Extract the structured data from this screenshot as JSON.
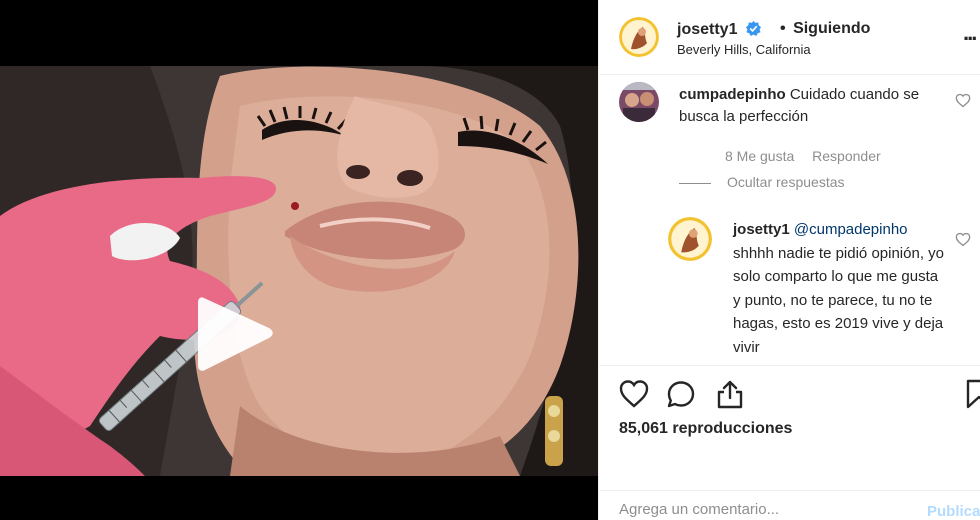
{
  "post": {
    "username": "josetty1",
    "separator": "•",
    "follow_state": "Siguiendo",
    "location": "Beverly Hills, California",
    "more": "..."
  },
  "comments": [
    {
      "username": "cumpadepinho",
      "text": "Cuidado cuando se busca la perfección",
      "likes": "8 Me gusta",
      "reply_label": "Responder",
      "hide_replies": "Ocultar respuestas"
    }
  ],
  "reply": {
    "username": "josetty1",
    "mention": "@cumpadepinho",
    "text": "shhhh nadie te pidió opinión, yo solo comparto lo que me gusta y punto, no te parece, tu no te hagas, esto es 2019 vive y deja vivir"
  },
  "stats": {
    "views": "85,061 reproducciones"
  },
  "composer": {
    "placeholder": "Agrega un comentario...",
    "post_label": "Publicar"
  },
  "icons": {
    "play": "play-icon",
    "verified": "verified-badge-icon",
    "like": "heart-icon",
    "comment": "comment-bubble-icon",
    "share": "share-icon",
    "save": "bookmark-icon",
    "more": "more-options-icon"
  },
  "colors": {
    "verified": "#3897f0",
    "link": "#00376b",
    "muted": "#8e8e8e",
    "post_disabled": "#b3dbff",
    "glove": "#e86a86"
  }
}
